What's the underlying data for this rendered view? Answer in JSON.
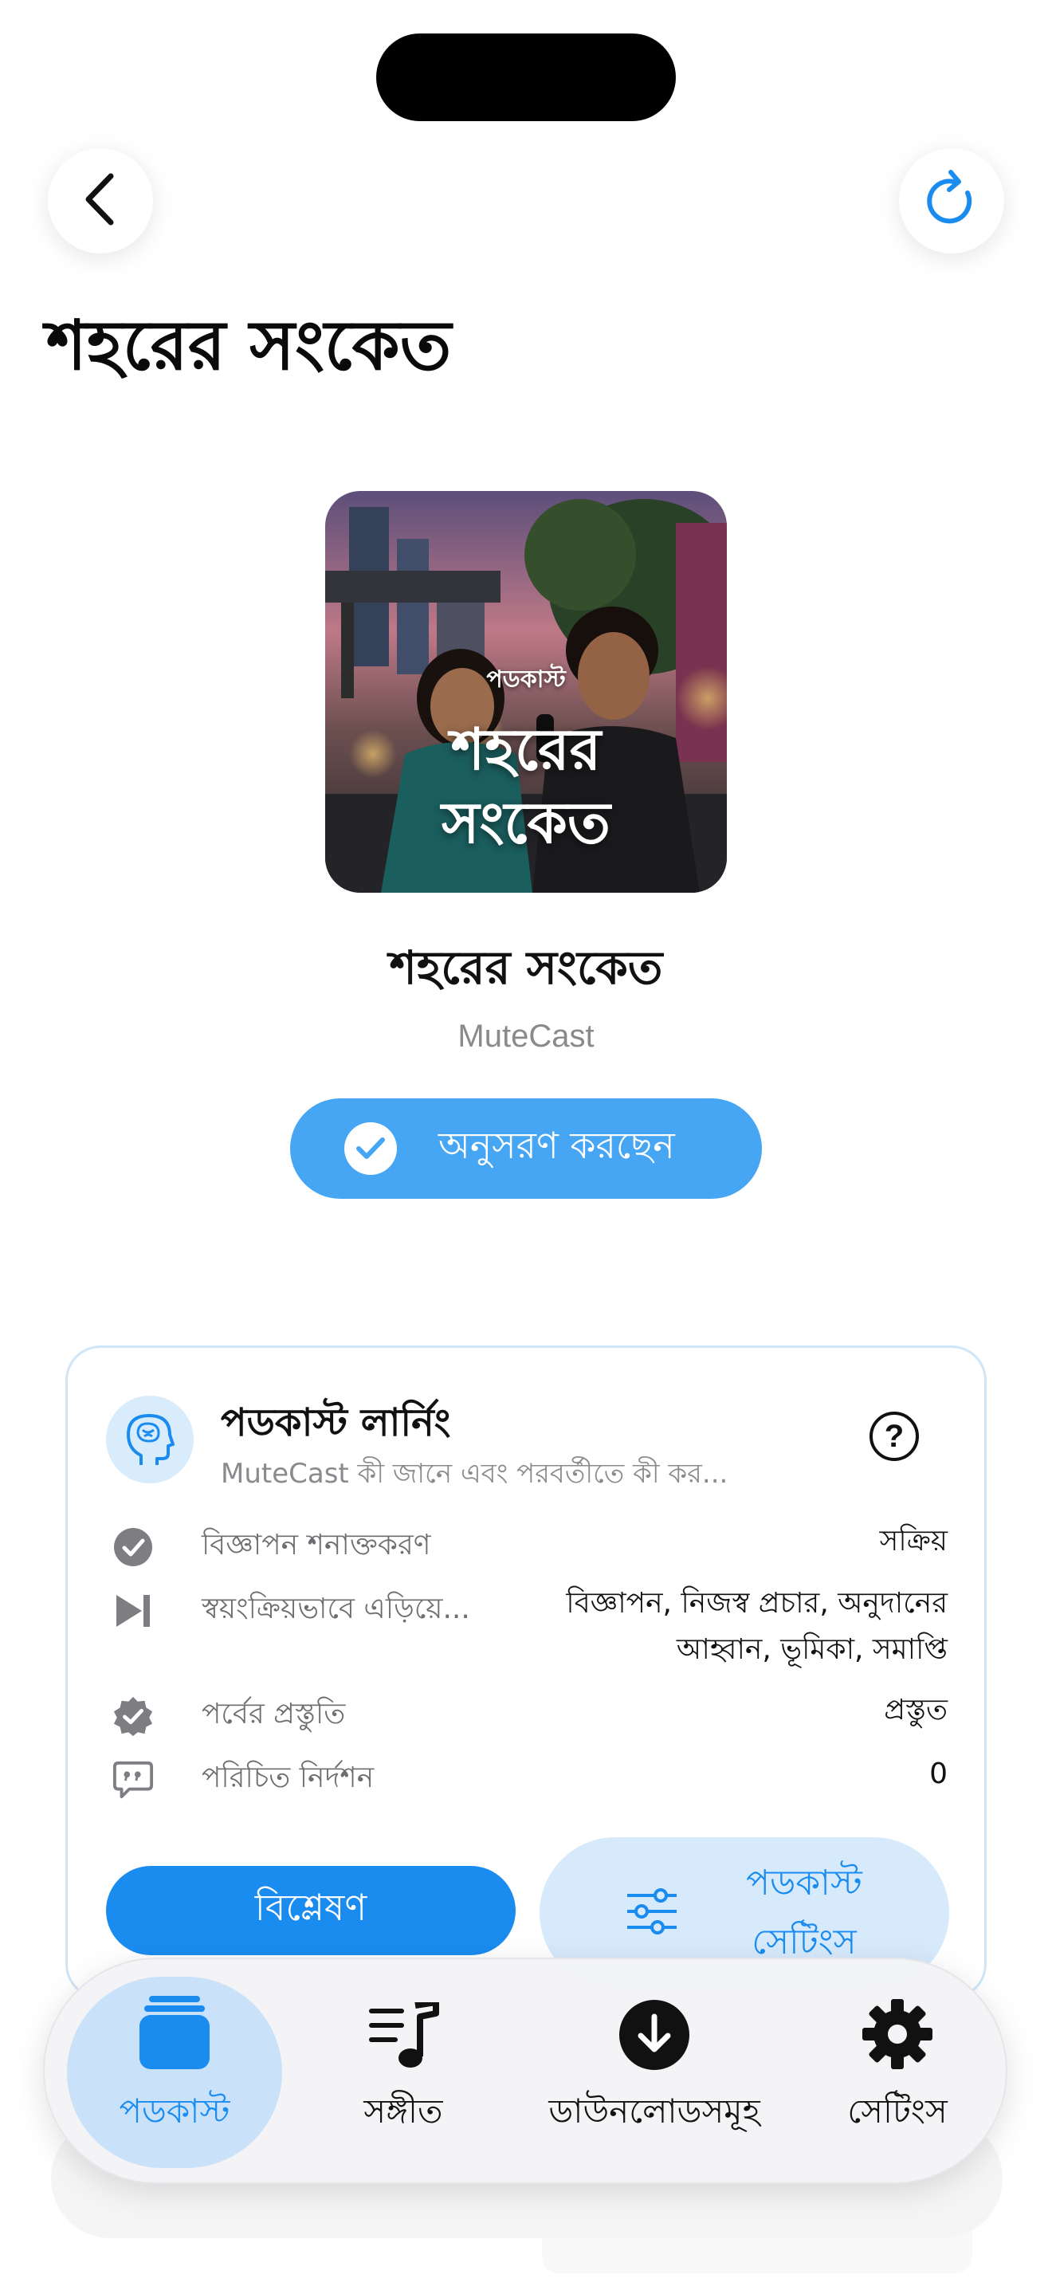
{
  "page": {
    "title": "শহরের সংকেত"
  },
  "header": {
    "back_icon": "chevron-left-icon",
    "refresh_icon": "refresh-icon"
  },
  "podcast": {
    "artwork_tag": "পডকাস্ট",
    "artwork_title_line1": "শহরের",
    "artwork_title_line2": "সংকেত",
    "title": "শহরের সংকেত",
    "author": "MuteCast",
    "follow_label": "অনুসরণ করছেন"
  },
  "learning": {
    "title": "পডকাস্ট লার্নিং",
    "subtitle": "MuteCast কী জানে এবং পরবর্তীতে কী কর...",
    "rows": [
      {
        "icon": "check-circle-icon",
        "label": "বিজ্ঞাপন শনাক্তকরণ",
        "value": "সক্রিয়"
      },
      {
        "icon": "skip-forward-icon",
        "label": "স্বয়ংক্রিয়ভাবে এড়িয়ে...",
        "value_line1": "বিজ্ঞাপন, নিজস্ব প্রচার, অনুদানের",
        "value_line2": "আহ্বান, ভূমিকা, সমাপ্তি"
      },
      {
        "icon": "verified-badge-icon",
        "label": "পর্বের প্রস্তুতি",
        "value": "প্রস্তুত"
      },
      {
        "icon": "quote-bubble-icon",
        "label": "পরিচিত নির্দশন",
        "value": "0"
      }
    ],
    "analyze_label": "বিশ্লেষণ",
    "settings_line1": "পডকাস্ট",
    "settings_line2": "সেটিংস"
  },
  "tabbar": {
    "tabs": [
      {
        "label": "পডকাস্ট",
        "icon": "podcast-stack-icon",
        "active": true
      },
      {
        "label": "সঙ্গীত",
        "icon": "music-list-icon",
        "active": false
      },
      {
        "label": "ডাউনলোডসমূহ",
        "icon": "download-circle-icon",
        "active": false
      },
      {
        "label": "সেটিংস",
        "icon": "gear-icon",
        "active": false
      }
    ]
  },
  "colors": {
    "accent": "#1a8cf0",
    "follow_bg": "#46a6f4",
    "settings_bg": "#d7eafb"
  }
}
